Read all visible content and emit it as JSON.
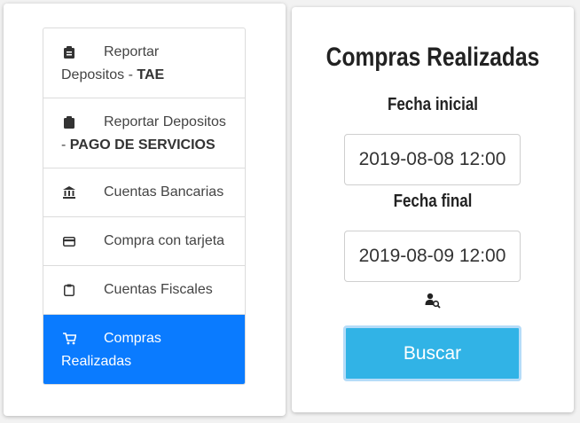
{
  "sidebar": {
    "items": [
      {
        "label_top": "Reportar",
        "label_rest": "Depositos - ",
        "label_bold": "TAE",
        "icon": "clipboard-list-icon"
      },
      {
        "label_top": "Reportar Depositos",
        "label_rest": "- ",
        "label_bold": "PAGO DE SERVICIOS",
        "icon": "clipboard-icon"
      },
      {
        "label": "Cuentas Bancarias",
        "icon": "bank-icon"
      },
      {
        "label": "Compra con tarjeta",
        "icon": "credit-card-icon"
      },
      {
        "label": "Cuentas Fiscales",
        "icon": "clipboard-outline-icon"
      },
      {
        "label_top": "Compras",
        "label_rest": "Realizadas",
        "icon": "cart-icon",
        "active": true
      }
    ]
  },
  "main": {
    "title": "Compras Realizadas",
    "start_label": "Fecha inicial",
    "start_value": "2019-08-08 12:00",
    "end_label": "Fecha final",
    "end_value": "2019-08-09 12:00",
    "search_button": "Buscar",
    "search_user_icon": "user-search-icon"
  },
  "colors": {
    "active": "#0a7bff",
    "button": "#31b3e6"
  }
}
